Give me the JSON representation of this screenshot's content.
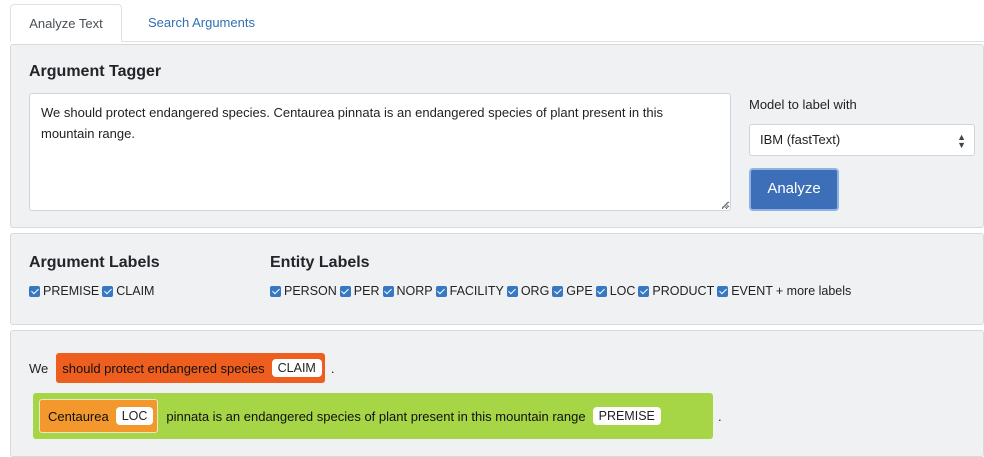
{
  "tabs": [
    {
      "label": "Analyze Text",
      "active": true
    },
    {
      "label": "Search Arguments",
      "active": false
    }
  ],
  "tagger": {
    "title": "Argument Tagger",
    "text_value": "We should protect endangered species. Centaurea pinnata is an endangered species of plant present in this mountain range.",
    "model_label": "Model to label with",
    "model_selected": "IBM (fastText)",
    "analyze_label": "Analyze"
  },
  "labels": {
    "argument_title": "Argument Labels",
    "argument_items": [
      "PREMISE",
      "CLAIM"
    ],
    "entity_title": "Entity Labels",
    "entity_items": [
      "PERSON",
      "PER",
      "NORP",
      "FACILITY",
      "ORG",
      "GPE",
      "LOC",
      "PRODUCT",
      "EVENT"
    ],
    "more_text": "+ more labels"
  },
  "output": {
    "line1_prefix": "We",
    "claim_text": "should protect endangered species",
    "claim_tag": "CLAIM",
    "line1_suffix": ".",
    "entity_text": "Centaurea",
    "entity_tag": "LOC",
    "premise_text": "pinnata is an endangered species of plant present in this mountain range",
    "premise_tag": "PREMISE",
    "line2_suffix": "."
  },
  "colors": {
    "claim": "#ee5e1e",
    "premise": "#a6d546",
    "loc": "#f2982d",
    "button": "#3c6fb8",
    "checkbox": "#3778c4"
  }
}
